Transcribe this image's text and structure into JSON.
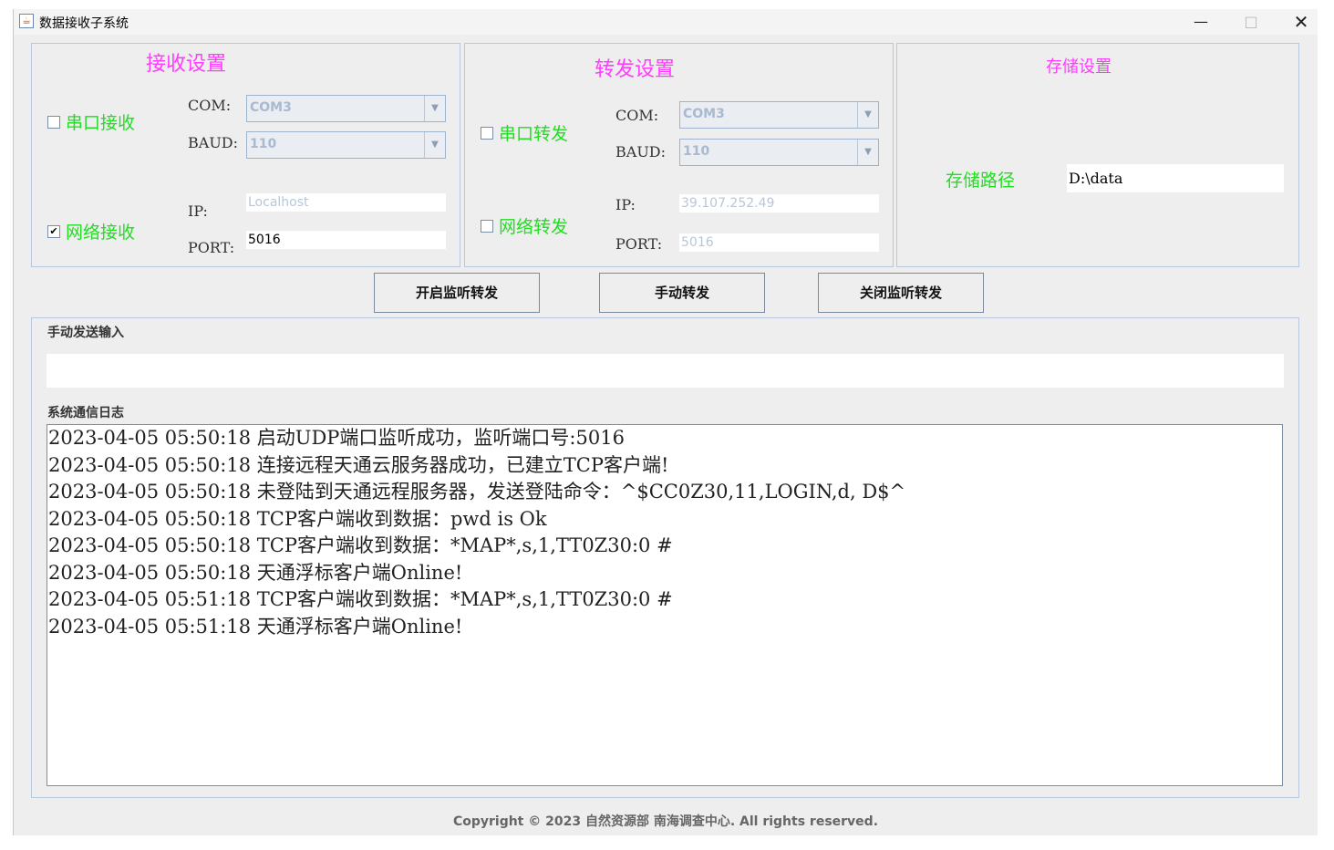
{
  "window": {
    "title": "数据接收子系统",
    "controls": {
      "minimize": "—",
      "maximize": "□",
      "close": "✕"
    }
  },
  "receive": {
    "title": "接收设置",
    "serial_label": "串口接收",
    "serial_checked": false,
    "com_label": "COM:",
    "com_value": "COM3",
    "baud_label": "BAUD:",
    "baud_value": "110",
    "network_label": "网络接收",
    "network_checked": true,
    "ip_label": "IP:",
    "ip_value": "Localhost",
    "port_label": "PORT:",
    "port_value": "5016"
  },
  "forward": {
    "title": "转发设置",
    "serial_label": "串口转发",
    "serial_checked": false,
    "com_label": "COM:",
    "com_value": "COM3",
    "baud_label": "BAUD:",
    "baud_value": "110",
    "network_label": "网络转发",
    "network_checked": false,
    "ip_label": "IP:",
    "ip_value": "39.107.252.49",
    "port_label": "PORT:",
    "port_value": "5016"
  },
  "storage": {
    "title": "存储设置",
    "path_label": "存储路径",
    "path_value": "D:\\data"
  },
  "buttons": {
    "start": "开启监听转发",
    "manual": "手动转发",
    "stop": "关闭监听转发"
  },
  "manual_input": {
    "label": "手动发送输入",
    "value": ""
  },
  "log": {
    "label": "系统通信日志",
    "lines": [
      "2023-04-05 05:50:18 启动UDP端口监听成功，监听端口号:5016",
      "2023-04-05 05:50:18 连接远程天通云服务器成功，已建立TCP客户端!",
      "2023-04-05 05:50:18 未登陆到天通远程服务器，发送登陆命令：^$CC0Z30,11,LOGIN,d, D$^",
      "2023-04-05 05:50:18 TCP客户端收到数据：pwd is Ok",
      "2023-04-05 05:50:18 TCP客户端收到数据：*MAP*,s,1,TT0Z30:0 #",
      "2023-04-05 05:50:18 天通浮标客户端Online!",
      "2023-04-05 05:51:18 TCP客户端收到数据：*MAP*,s,1,TT0Z30:0 #",
      "2023-04-05 05:51:18 天通浮标客户端Online!"
    ]
  },
  "footer": "Copyright © 2023  自然资源部 南海调查中心. All rights reserved."
}
